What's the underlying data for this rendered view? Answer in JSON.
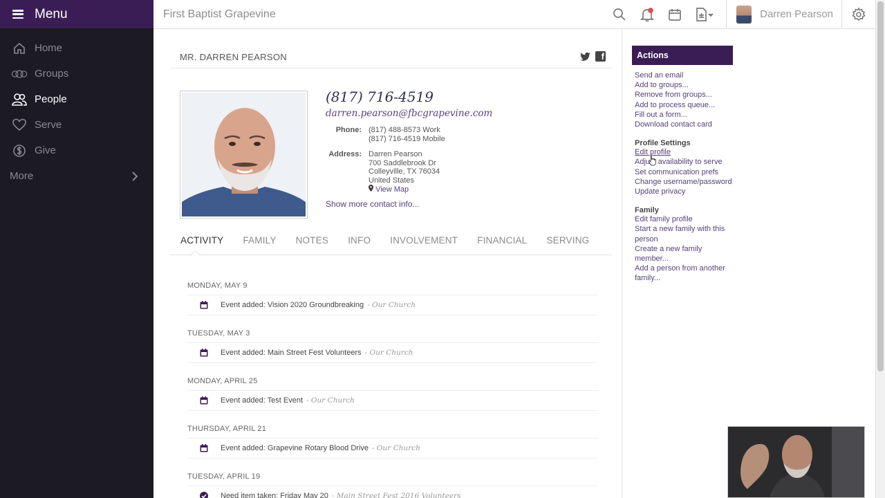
{
  "sidebar": {
    "menu_label": "Menu",
    "items": [
      {
        "label": "Home",
        "icon": "home-icon"
      },
      {
        "label": "Groups",
        "icon": "groups-icon"
      },
      {
        "label": "People",
        "icon": "people-icon",
        "active": true
      },
      {
        "label": "Serve",
        "icon": "heart-icon"
      },
      {
        "label": "Give",
        "icon": "dollar-icon"
      }
    ],
    "more_label": "More"
  },
  "topbar": {
    "church_name": "First Baptist Grapevine",
    "user_name": "Darren Pearson"
  },
  "person": {
    "title": "MR. DARREN PEARSON",
    "phone_big": "(817) 716-4519",
    "email_big": "darren.pearson@fbcgrapevine.com",
    "phone_label": "Phone:",
    "phones": [
      "(817) 488-8573 Work",
      "(817) 716-4519 Mobile"
    ],
    "address_label": "Address:",
    "address": [
      "Darren Pearson",
      "700 Saddlebrook Dr",
      "Colleyville, TX 76034",
      "United States"
    ],
    "view_map": "View Map",
    "show_more": "Show more contact info..."
  },
  "tabs": [
    "ACTIVITY",
    "FAMILY",
    "NOTES",
    "INFO",
    "INVOLVEMENT",
    "FINANCIAL",
    "SERVING"
  ],
  "activity": [
    {
      "day": "MONDAY, MAY 9",
      "icon": "calendar-icon",
      "text": "Event added: Vision 2020 Groundbreaking",
      "source": "- Our Church"
    },
    {
      "day": "TUESDAY, MAY 3",
      "icon": "calendar-icon",
      "text": "Event added: Main Street Fest Volunteers",
      "source": "- Our Church"
    },
    {
      "day": "MONDAY, APRIL 25",
      "icon": "calendar-icon",
      "text": "Event added: Test Event",
      "source": "- Our Church"
    },
    {
      "day": "THURSDAY, APRIL 21",
      "icon": "calendar-icon",
      "text": "Event added: Grapevine Rotary Blood Drive",
      "source": "- Our Church"
    },
    {
      "day": "TUESDAY, APRIL 19",
      "icon": "check-circle-icon",
      "text": "Need item taken: Friday May 20",
      "source": "- Main Street Fest 2016 Volunteers"
    }
  ],
  "actions": {
    "header": "Actions",
    "links": [
      "Send an email",
      "Add to groups...",
      "Remove from groups...",
      "Add to process queue...",
      "Fill out a form...",
      "Download contact card"
    ],
    "profile_settings_label": "Profile Settings",
    "profile_links": [
      "Edit profile",
      "Adjust availability to serve",
      "Set communication prefs",
      "Change username/password",
      "Update privacy"
    ],
    "family_label": "Family",
    "family_links": [
      "Edit family profile",
      "Start a new family with this person",
      "Create a new family member...",
      "Add a person from another family..."
    ]
  },
  "colors": {
    "brand_purple": "#3b1d55",
    "sidebar_bg": "#1c1b24",
    "link_purple": "#553f7a"
  }
}
